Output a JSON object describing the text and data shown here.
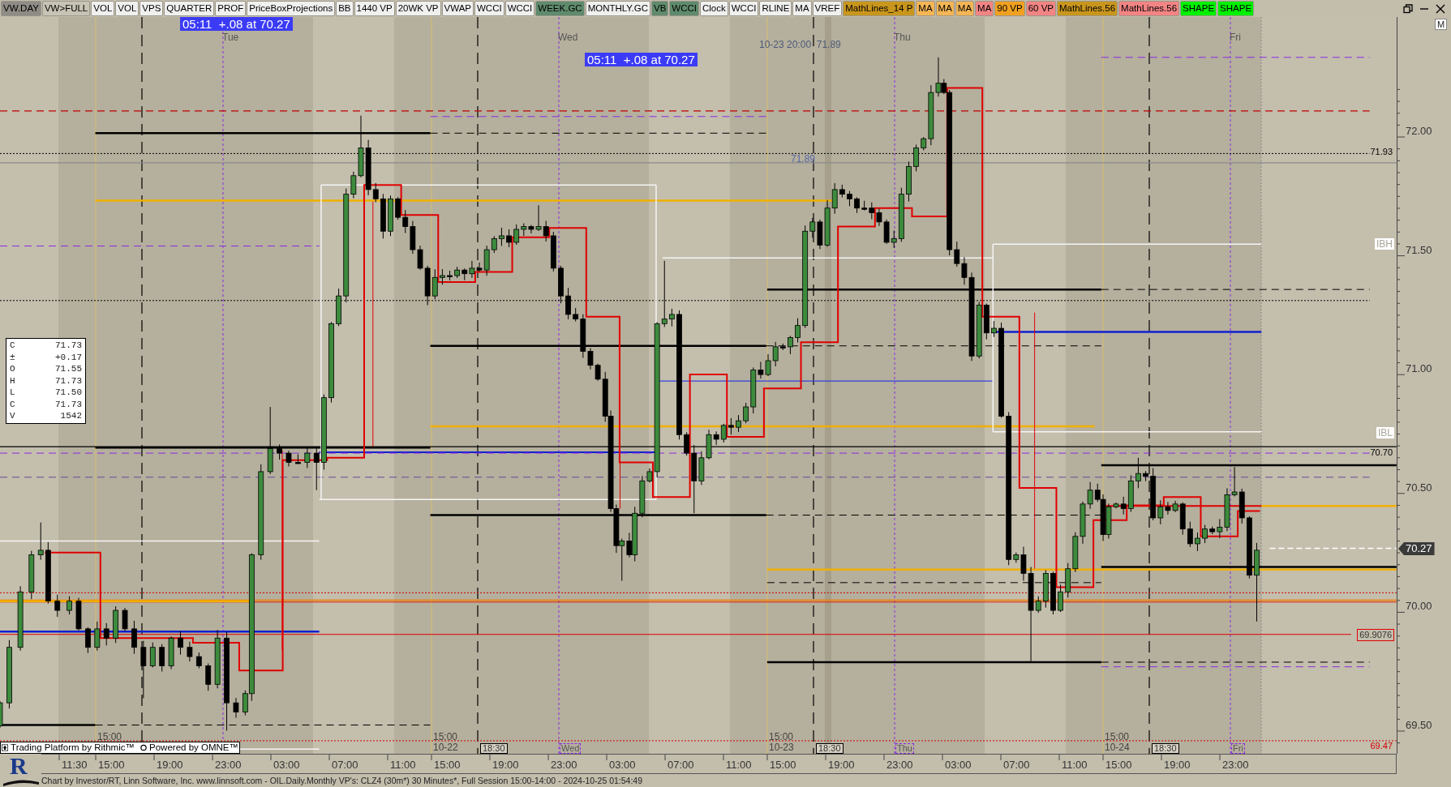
{
  "toolbar": {
    "buttons": [
      {
        "label": "VW.DAY",
        "color": "#8f8b85"
      },
      {
        "label": "VW>FULL",
        "color": "#c7c3b5"
      },
      {
        "label": "VOL",
        "color": "#f0f0f0"
      },
      {
        "label": "VOL",
        "color": "#f0f0f0"
      },
      {
        "label": "VPS",
        "color": "#f0f0f0"
      },
      {
        "label": "QUARTER",
        "color": "#f0f0f0"
      },
      {
        "label": "PROF",
        "color": "#f0f0f0"
      },
      {
        "label": "PriceBoxProjections",
        "color": "#f0f0f0"
      },
      {
        "label": "BB",
        "color": "#f0f0f0"
      },
      {
        "label": "1440 VP",
        "color": "#f0f0f0"
      },
      {
        "label": "20WK VP",
        "color": "#f0f0f0"
      },
      {
        "label": "VWAP",
        "color": "#f0f0f0"
      },
      {
        "label": "WCCI",
        "color": "#f0f0f0"
      },
      {
        "label": "WCCI",
        "color": "#f0f0f0"
      },
      {
        "label": "WEEK.GC",
        "color": "#5f8b6d"
      },
      {
        "label": "MONTHLY.GC",
        "color": "#f0f0f0"
      },
      {
        "label": "VB",
        "color": "#5f8b6d"
      },
      {
        "label": "WCCI",
        "color": "#5f8b6d"
      },
      {
        "label": "Clock",
        "color": "#f0f0f0"
      },
      {
        "label": "WCCI",
        "color": "#f0f0f0"
      },
      {
        "label": "RLINE",
        "color": "#f0f0f0"
      },
      {
        "label": "MA",
        "color": "#f0f0f0"
      },
      {
        "label": "VREF",
        "color": "#f0f0f0"
      },
      {
        "label": "MathLines_14 P",
        "color": "#c9961d"
      },
      {
        "label": "MA",
        "color": "#f4b555"
      },
      {
        "label": "MA",
        "color": "#f4b555"
      },
      {
        "label": "MA",
        "color": "#f4b555"
      },
      {
        "label": "MA",
        "color": "#f28484"
      },
      {
        "label": "90 VP",
        "color": "#f0a020"
      },
      {
        "label": "60 VP",
        "color": "#f28484"
      },
      {
        "label": "MathLines.56",
        "color": "#c9961d"
      },
      {
        "label": "MathLines.56",
        "color": "#f28484"
      },
      {
        "label": "SHAPE",
        "color": "#00f000"
      },
      {
        "label": "SHAPE",
        "color": "#00f000"
      }
    ]
  },
  "chart": {
    "clock_labels": [
      "05:11  +.08 at 70.27",
      "05:11  +.08 at 70.27"
    ],
    "day_labels": [
      "Tue",
      "Wed",
      "Thu",
      "Fri"
    ],
    "marker_label": "10-23 20:00  71.89",
    "level_note": "71.89",
    "data_box": {
      "rows": [
        {
          "key": "C",
          "value": "71.73"
        },
        {
          "key": "±",
          "value": "+0.17"
        },
        {
          "key": "O",
          "value": "71.55"
        },
        {
          "key": "H",
          "value": "71.73"
        },
        {
          "key": "L",
          "value": "71.50"
        },
        {
          "key": "C",
          "value": "71.73"
        },
        {
          "key": "V",
          "value": "1542"
        }
      ]
    },
    "line_labels": [
      {
        "text": "71.93",
        "kind": "plain"
      },
      {
        "text": "IBH",
        "kind": "boxed"
      },
      {
        "text": "IBL",
        "kind": "boxed"
      },
      {
        "text": "70.70",
        "kind": "plain"
      },
      {
        "text": "69.9076",
        "kind": "outlined"
      },
      {
        "text": "69.47",
        "kind": "alert"
      }
    ],
    "session_labels": [
      {
        "time": "15:00"
      },
      {
        "time": "15:00",
        "date": "10-22"
      },
      {
        "time": "15:00",
        "date": "10-23"
      },
      {
        "time": "15:00",
        "date": "10-24"
      }
    ],
    "close_markers": [
      "18:30",
      "18:30",
      "18:30"
    ],
    "day_markers": [
      "Wed",
      "Thu",
      "Fri"
    ],
    "branding": {
      "platform": "Trading Platform by Rithmic™",
      "powered": "Powered by OMNE™"
    }
  },
  "price_axis": {
    "labels": [
      "72.00",
      "71.50",
      "71.00",
      "70.50",
      "70.00",
      "69.50"
    ],
    "current_price": "70.27",
    "button": "M"
  },
  "time_axis": {
    "labels": [
      "11:30",
      "15:00",
      "19:00",
      "23:00",
      "03:00",
      "07:00",
      "11:00",
      "15:00",
      "19:00",
      "23:00",
      "03:00",
      "07:00",
      "11:00",
      "15:00",
      "19:00",
      "23:00",
      "03:00",
      "07:00",
      "11:00",
      "15:00",
      "19:00",
      "23:00"
    ]
  },
  "logo": {
    "letter": "R"
  },
  "status_bar": "Chart by Investor/RT, Linn Software, Inc. www.linnsoft.com - OIL.Daily.Monthly VP's: CLZ4 (30m*) 30 Minutes*, Full Session 15:00-14:00 - 2024-10-25 01:54:49"
}
